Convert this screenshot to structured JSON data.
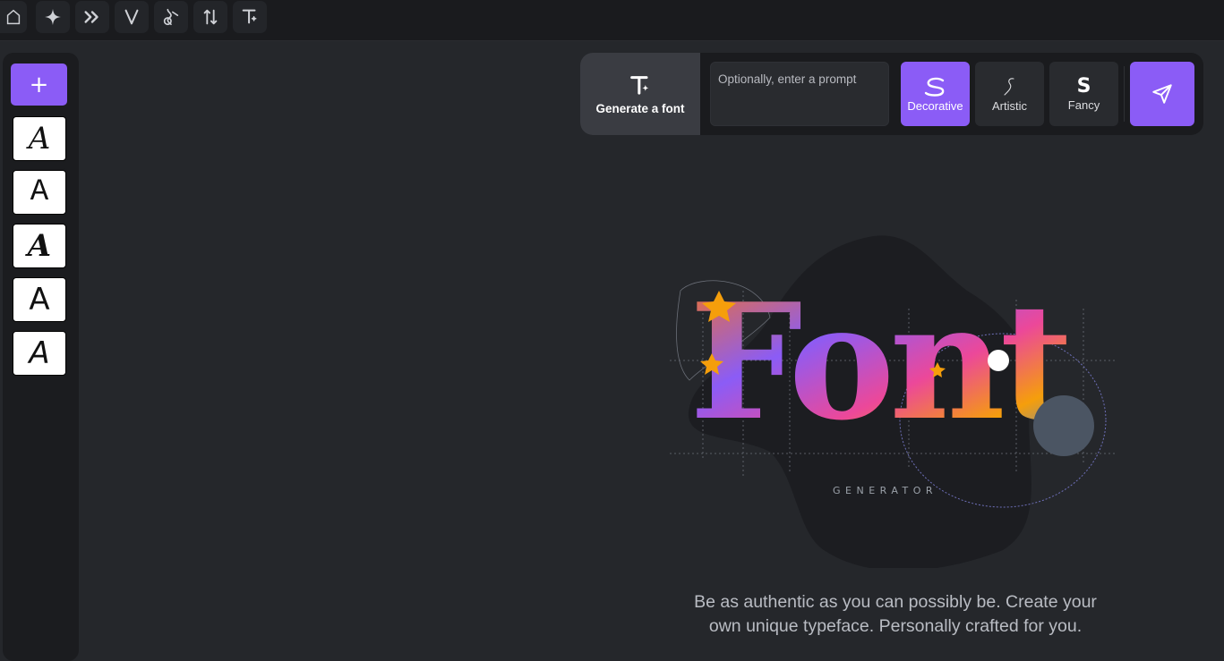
{
  "toolbar": {
    "icons": [
      "home-icon",
      "sparkle-icon",
      "double-chevron-icon",
      "v-letter-icon",
      "brush-icon",
      "swap-icon",
      "text-sparkle-icon"
    ]
  },
  "sidebar": {
    "add_label": "+",
    "glyphs": [
      "A",
      "A",
      "A",
      "A",
      "A"
    ]
  },
  "generator": {
    "tab_label": "Generate a font",
    "prompt_placeholder": "Optionally, enter a prompt",
    "styles": [
      {
        "name": "Decorative",
        "active": true
      },
      {
        "name": "Artistic",
        "active": false
      },
      {
        "name": "Fancy",
        "active": false
      }
    ],
    "send_icon": "send-icon"
  },
  "hero": {
    "title": "Font",
    "subtitle": "GENERATOR"
  },
  "tagline": {
    "line1": "Be as authentic as you can possibly be. Create your",
    "line2": "own unique typeface. Personally crafted for you."
  },
  "colors": {
    "accent": "#8b5cf6",
    "background": "#25272b",
    "panel": "#1a1b1e"
  }
}
